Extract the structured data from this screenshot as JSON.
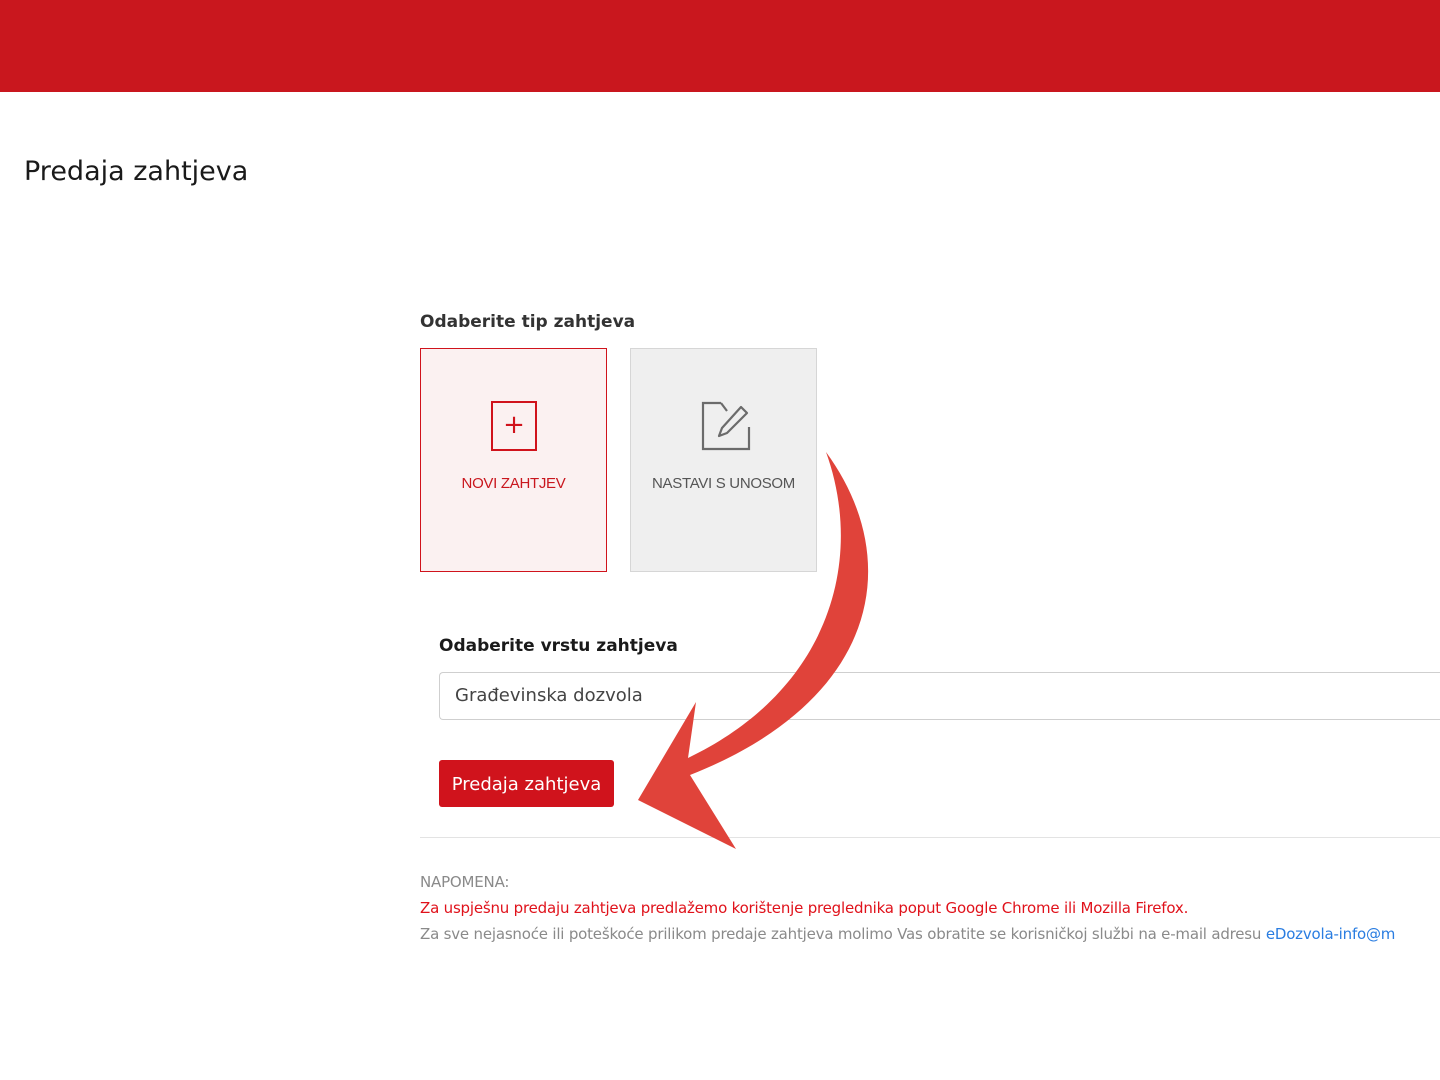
{
  "page": {
    "title": "Predaja zahtjeva"
  },
  "request_type": {
    "label": "Odaberite tip zahtjeva",
    "options": [
      {
        "label": "NOVI ZAHTJEV",
        "icon": "plus-square-icon",
        "selected": true
      },
      {
        "label": "NASTAVI S UNOSOM",
        "icon": "edit-document-icon",
        "selected": false
      }
    ]
  },
  "request_kind": {
    "label": "Odaberite vrstu zahtjeva",
    "selected_value": "Građevinska dozvola"
  },
  "submit": {
    "label": "Predaja zahtjeva"
  },
  "note": {
    "title": "NAPOMENA:",
    "browser_text": "Za uspješnu predaju zahtjeva predlažemo korištenje preglednika poput Google Chrome ili Mozilla Firefox.",
    "support_text": "Za sve nejasnoće ili poteškoće prilikom predaje zahtjeva molimo Vas obratite se korisničkoj službi na e-mail adresu ",
    "support_email": "eDozvola-info@m"
  },
  "colors": {
    "brand_red": "#c9171e",
    "selected_tile_bg": "#fbf1f1",
    "link_blue": "#2a7de1",
    "annotation_arrow": "#e0433a"
  },
  "annotation": {
    "icon": "curved-arrow-icon"
  }
}
